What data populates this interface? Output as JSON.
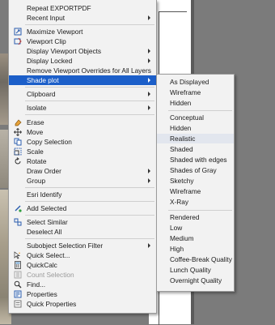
{
  "context_menu": {
    "items": [
      {
        "label": "Repeat EXPORTPDF"
      },
      {
        "label": "Recent Input"
      },
      {
        "label": "Maximize Viewport"
      },
      {
        "label": "Viewport Clip"
      },
      {
        "label": "Display Viewport Objects"
      },
      {
        "label": "Display Locked"
      },
      {
        "label": "Remove Viewport Overrides for All Layers"
      },
      {
        "label": "Shade plot"
      },
      {
        "label": "Clipboard"
      },
      {
        "label": "Isolate"
      },
      {
        "label": "Erase"
      },
      {
        "label": "Move"
      },
      {
        "label": "Copy Selection"
      },
      {
        "label": "Scale"
      },
      {
        "label": "Rotate"
      },
      {
        "label": "Draw Order"
      },
      {
        "label": "Group"
      },
      {
        "label": "Esri Identify"
      },
      {
        "label": "Add Selected"
      },
      {
        "label": "Select Similar"
      },
      {
        "label": "Deselect All"
      },
      {
        "label": "Subobject Selection Filter"
      },
      {
        "label": "Quick Select..."
      },
      {
        "label": "QuickCalc"
      },
      {
        "label": "Count Selection"
      },
      {
        "label": "Find..."
      },
      {
        "label": "Properties"
      },
      {
        "label": "Quick Properties"
      }
    ]
  },
  "shade_plot_submenu": {
    "items": [
      {
        "label": "As Displayed"
      },
      {
        "label": "Wireframe"
      },
      {
        "label": "Hidden"
      },
      {
        "label": "Conceptual"
      },
      {
        "label": "Hidden"
      },
      {
        "label": "Realistic"
      },
      {
        "label": "Shaded"
      },
      {
        "label": "Shaded with edges"
      },
      {
        "label": "Shades of Gray"
      },
      {
        "label": "Sketchy"
      },
      {
        "label": "Wireframe"
      },
      {
        "label": "X-Ray"
      },
      {
        "label": "Rendered"
      },
      {
        "label": "Low"
      },
      {
        "label": "Medium"
      },
      {
        "label": "High"
      },
      {
        "label": "Coffee-Break Quality"
      },
      {
        "label": "Lunch Quality"
      },
      {
        "label": "Overnight Quality"
      }
    ]
  },
  "colors": {
    "highlight": "#1c5fc9",
    "menu_background": "#f2f2f2",
    "disabled_text": "#9a9a9a",
    "canvas_background": "#7b7b7b"
  },
  "icons": {
    "maximize_viewport": "maximize-viewport-icon",
    "viewport_clip": "viewport-clip-icon",
    "erase": "erase-icon",
    "move": "move-icon",
    "copy_selection": "copy-icon",
    "scale": "scale-icon",
    "rotate": "rotate-icon",
    "add_selected": "add-selected-icon",
    "select_similar": "select-similar-icon",
    "quick_select": "quick-select-icon",
    "quickcalc": "calculator-icon",
    "count_selection": "count-icon",
    "find": "find-icon",
    "properties": "properties-icon",
    "quick_properties": "quick-properties-icon"
  }
}
